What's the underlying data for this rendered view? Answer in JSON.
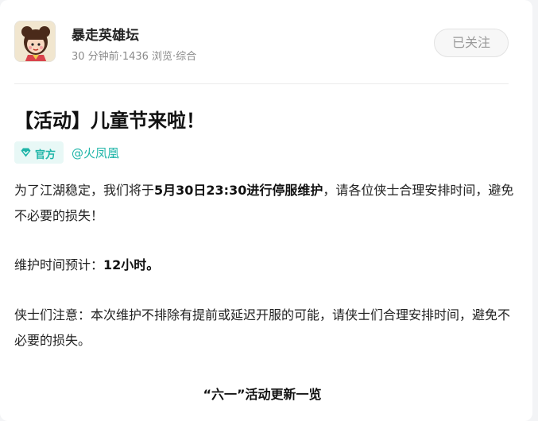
{
  "header": {
    "forum_name": "暴走英雄坛",
    "time_ago": "30 分钟前",
    "views": "1436 浏览",
    "category": "综合",
    "meta_sep": "·",
    "follow_label": "已关注"
  },
  "post": {
    "title": "【活动】儿童节来啦！",
    "official_badge": "官方",
    "author": "@火凤凰",
    "p1_pre": "为了江湖稳定，我们将于",
    "p1_bold": "5月30日23:30进行停服维护",
    "p1_post": "，请各位侠士合理安排时间，避免不必要的损失！",
    "p2_pre": "维护时间预计：",
    "p2_bold": "12小时。",
    "p3": "侠士们注意：本次维护不排除有提前或延迟开服的可能，请侠士们合理安排时间，避免不必要的损失。",
    "subheading": "“六一”活动更新一览"
  },
  "colors": {
    "accent": "#1fb5a8",
    "badge_bg": "#e8f8f6",
    "meta_text": "#8a8a8a"
  },
  "icons": {
    "avatar": "forum-avatar-cartoon-girl",
    "official": "diamond-icon"
  }
}
